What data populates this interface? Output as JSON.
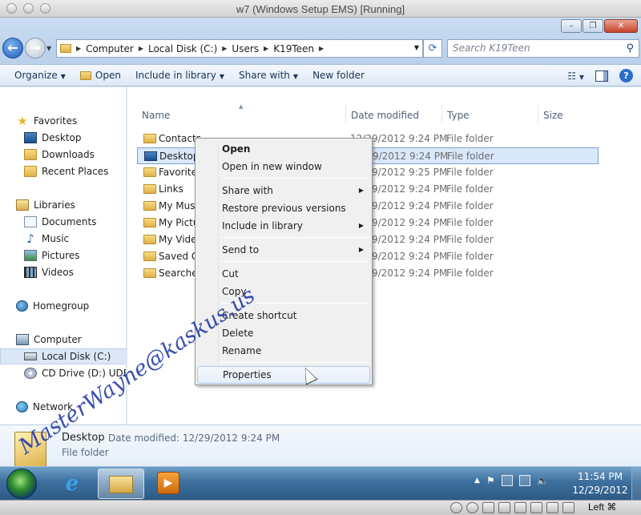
{
  "host_window": {
    "title": "w7 (Windows Setup EMS) [Running]"
  },
  "window_controls": {
    "minimize": "–",
    "maximize": "❐",
    "close": "✕"
  },
  "address_bar": {
    "crumbs": [
      "Computer",
      "Local Disk (C:)",
      "Users",
      "K19Teen"
    ],
    "search_placeholder": "Search K19Teen"
  },
  "command_bar": {
    "organize": "Organize",
    "open": "Open",
    "include_in_library": "Include in library",
    "share_with": "Share with",
    "new_folder": "New folder"
  },
  "nav_pane": {
    "favorites": {
      "label": "Favorites",
      "items": [
        "Desktop",
        "Downloads",
        "Recent Places"
      ]
    },
    "libraries": {
      "label": "Libraries",
      "items": [
        "Documents",
        "Music",
        "Pictures",
        "Videos"
      ]
    },
    "homegroup": "Homegroup",
    "computer": {
      "label": "Computer",
      "items": [
        "Local Disk (C:)",
        "CD Drive (D:) UDF Vo"
      ]
    },
    "network": "Network"
  },
  "file_list": {
    "columns": {
      "name": "Name",
      "date_modified": "Date modified",
      "type": "Type",
      "size": "Size"
    },
    "rows": [
      {
        "name": "Contacts",
        "date": "12/29/2012 9:24 PM",
        "type": "File folder"
      },
      {
        "name": "Desktop",
        "date": "12/29/2012 9:24 PM",
        "type": "File folder"
      },
      {
        "name": "Favorites",
        "date": "12/29/2012 9:25 PM",
        "type": "File folder"
      },
      {
        "name": "Links",
        "date": "12/29/2012 9:24 PM",
        "type": "File folder"
      },
      {
        "name": "My Music",
        "date": "12/29/2012 9:24 PM",
        "type": "File folder"
      },
      {
        "name": "My Pictures",
        "date": "12/29/2012 9:24 PM",
        "type": "File folder"
      },
      {
        "name": "My Videos",
        "date": "12/29/2012 9:24 PM",
        "type": "File folder"
      },
      {
        "name": "Saved Games",
        "date": "12/29/2012 9:24 PM",
        "type": "File folder"
      },
      {
        "name": "Searches",
        "date": "12/29/2012 9:24 PM",
        "type": "File folder"
      }
    ]
  },
  "context_menu": {
    "open": "Open",
    "open_new_window": "Open in new window",
    "share_with": "Share with",
    "restore_previous": "Restore previous versions",
    "include_in_library": "Include in library",
    "send_to": "Send to",
    "cut": "Cut",
    "copy": "Copy",
    "create_shortcut": "Create shortcut",
    "delete": "Delete",
    "rename": "Rename",
    "properties": "Properties"
  },
  "details_pane": {
    "name": "Desktop",
    "modified": "Date modified: 12/29/2012 9:24 PM",
    "type": "File folder"
  },
  "taskbar": {
    "time": "11:54 PM",
    "date": "12/29/2012"
  },
  "vbox": {
    "host_key": "Left ⌘"
  },
  "watermark": "MasterWayne@kaskus.us"
}
